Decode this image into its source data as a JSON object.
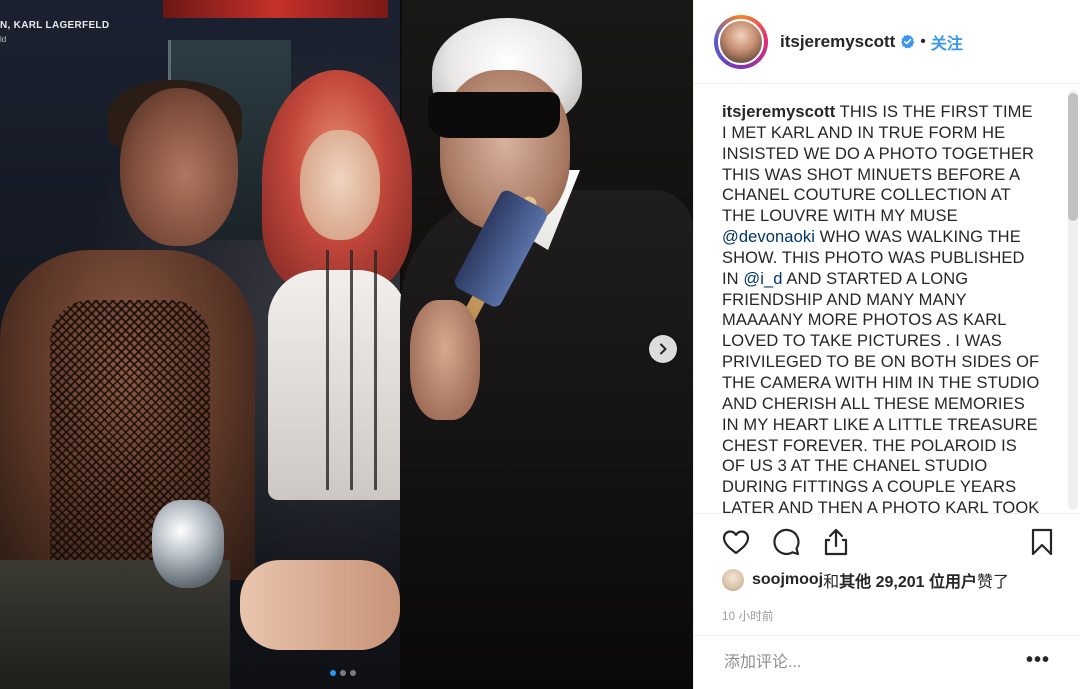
{
  "photo": {
    "magazine_caption": "N, KARL LAGERFELD",
    "magazine_caption_sub": "ld",
    "carousel": {
      "total_slides": 3,
      "active_slide": 1
    }
  },
  "header": {
    "username": "itsjeremyscott",
    "verified": true,
    "separator": "•",
    "follow_label": "关注"
  },
  "caption": {
    "username": "itsjeremyscott",
    "text_part1": " THIS IS THE FIRST TIME I MET KARL AND IN TRUE FORM HE INSISTED WE DO A PHOTO TOGETHER THIS WAS SHOT MINUETS BEFORE A CHANEL COUTURE COLLECTION AT THE LOUVRE WITH MY MUSE ",
    "mention1": "@devonaoki",
    "text_part2": " WHO WAS WALKING THE SHOW. THIS PHOTO WAS PUBLISHED IN ",
    "mention2": "@i_d",
    "text_part3": " AND STARTED A LONG FRIENDSHIP AND MANY MANY MAAAANY MORE PHOTOS AS KARL LOVED TO TAKE PICTURES . I WAS PRIVILEGED TO BE ON BOTH SIDES OF THE CAMERA WITH HIM IN THE STUDIO AND CHERISH ALL THESE MEMORIES IN MY HEART LIKE A LITTLE TREASURE CHEST FOREVER. THE POLAROID IS OF US 3 AT THE CHANEL STUDIO DURING FITTINGS A COUPLE YEARS LATER AND THEN A PHOTO KARL TOOK OF DEV AND I AT HIS STUDIO I Z"
  },
  "likes": {
    "liker_username": "soojmooj",
    "connector": " 和 ",
    "others_label": "其他 29,201 位用户",
    "suffix": " 赞了"
  },
  "timestamp": "10 小时前",
  "comment": {
    "placeholder": "添加评论..."
  },
  "more_label": "•••",
  "colors": {
    "accent": "#3897f0",
    "verified_badge": "#3897f0",
    "carousel_active_dot": "#1d9bf0",
    "mention": "#003569"
  }
}
